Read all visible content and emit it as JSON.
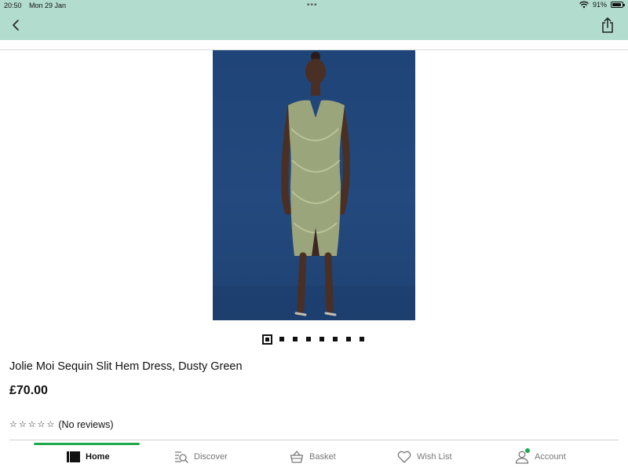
{
  "status_bar": {
    "time": "20:50",
    "date": "Mon 29 Jan",
    "multitask_dots": "•••",
    "battery_percent": "91%",
    "battery_level": 0.91
  },
  "header": {
    "back_icon": "chevron-left-icon",
    "share_icon": "share-icon",
    "background_color": "#b2dccd"
  },
  "product": {
    "image_description_icon": "product-photo",
    "image_count": 8,
    "active_image_index": 0,
    "title": "Jolie Moi Sequin Slit Hem Dress, Dusty Green",
    "price": "£70.00",
    "stars": [
      "☆",
      "☆",
      "☆",
      "☆",
      "☆"
    ],
    "reviews_text": "(No reviews)"
  },
  "tabbar": {
    "accent_color": "#1ba94c",
    "tabs": [
      {
        "label": "Home",
        "icon": "home-icon",
        "active": true
      },
      {
        "label": "Discover",
        "icon": "discover-search-icon",
        "active": false
      },
      {
        "label": "Basket",
        "icon": "basket-icon",
        "active": false
      },
      {
        "label": "Wish List",
        "icon": "heart-icon",
        "active": false
      },
      {
        "label": "Account",
        "icon": "account-icon",
        "active": false
      }
    ]
  }
}
